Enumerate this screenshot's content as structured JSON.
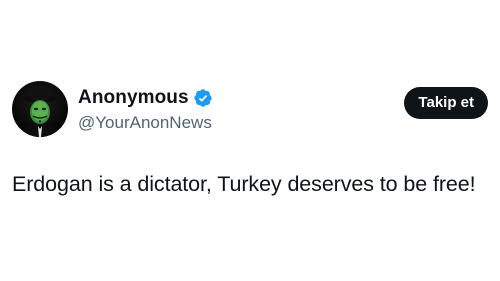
{
  "author": {
    "display_name": "Anonymous",
    "handle": "@YourAnonNews",
    "verified": true,
    "avatar_icon": "guy-fawkes-mask-avatar"
  },
  "actions": {
    "follow_label": "Takip et"
  },
  "tweet": {
    "text": "Erdogan is a dictator, Turkey deserves to be free!"
  },
  "colors": {
    "text_primary": "#0f1419",
    "text_secondary": "#536471",
    "verified_badge": "#1d9bf0",
    "follow_button_bg": "#0f1419",
    "background": "#ffffff"
  }
}
